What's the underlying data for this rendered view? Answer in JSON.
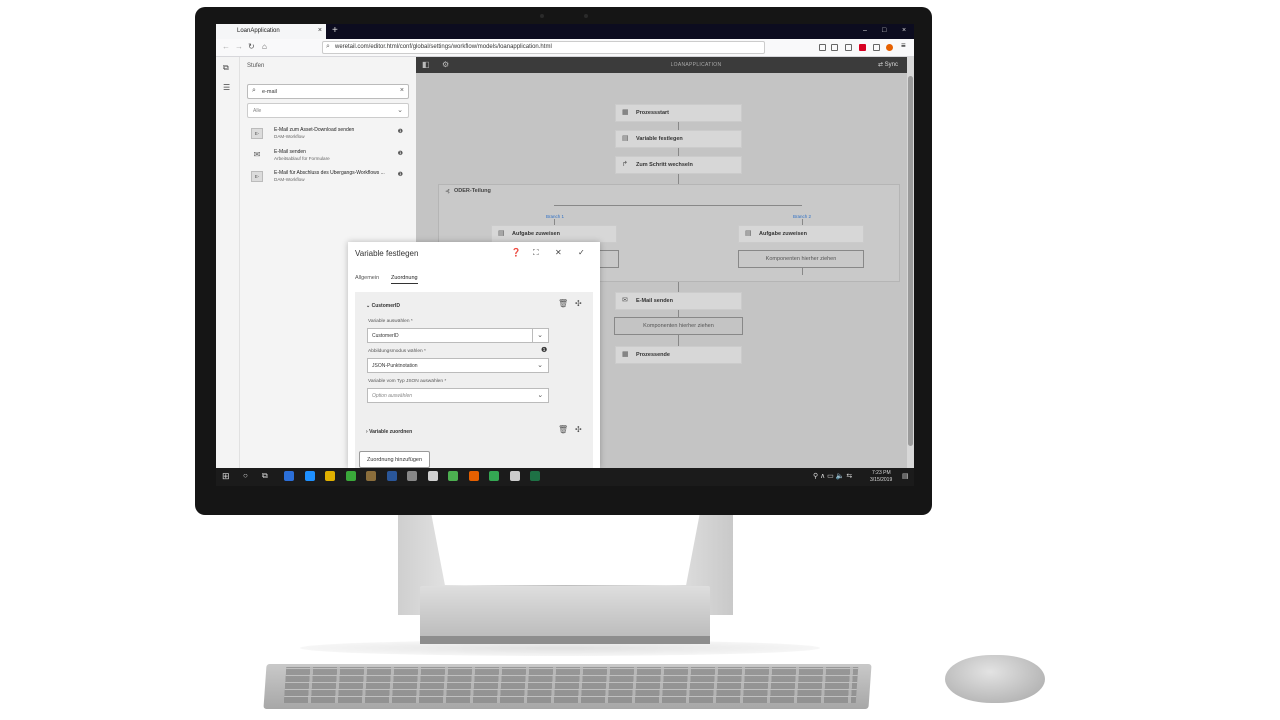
{
  "browser": {
    "tab_title": "LoanApplication",
    "tab_close": "×",
    "new_tab": "+",
    "window_controls": [
      "–",
      "□",
      "×"
    ],
    "url": "weretail.com/editor.html/conf/global/settings/workflow/models/loanapplication.html",
    "nav_icons": [
      "back-icon",
      "forward-icon",
      "reload-icon",
      "home-icon"
    ]
  },
  "rail": {
    "icons": [
      "copy-icon",
      "list-icon"
    ]
  },
  "sidebar": {
    "title": "Stufen",
    "search_value": "e-mail",
    "filter_value": "Alle",
    "steps": [
      {
        "icon_text": "E-",
        "name": "E-Mail zum Asset-Download senden",
        "sub": "DAM-Workflow"
      },
      {
        "icon_text": "✉",
        "name": "E-Mail senden",
        "sub": "Arbeitsablauf für Formulare"
      },
      {
        "icon_text": "E-",
        "name": "E-Mail für Abschluss des Übergangs-Workflows ...",
        "sub": "DAM-Workflow"
      }
    ]
  },
  "canvas": {
    "title": "LOANAPPLICATION",
    "sync_label": "Sync",
    "nodes": {
      "start": "Prozessstart",
      "set_variable": "Variable festlegen",
      "goto_step": "Zum Schritt wechseln",
      "or_split": "ODER-Teilung",
      "branch1": "Branch 1",
      "branch2": "Branch 2",
      "assign_task_1": "Aufgabe zuweisen",
      "assign_task_2": "Aufgabe zuweisen",
      "drag_here_1": "Komponenten hierher ziehen",
      "send_email": "E-Mail senden",
      "drag_here_2": "Komponenten hierher ziehen",
      "end": "Prozessende"
    }
  },
  "dialog": {
    "title": "Variable festlegen",
    "tabs": [
      "Allgemein",
      "Zuordnung"
    ],
    "active_tab": "Zuordnung",
    "section1_title": "CustomerID",
    "label_variable": "Variable auswählen *",
    "value_variable": "CustomerID",
    "label_mode": "Abbildungsmodus wählen *",
    "value_mode": "JSON-Punktnotation",
    "label_json": "Variable vom Typ JSON auswählen *",
    "placeholder_json": "Option auswählen",
    "section2_title": "Variable zuordnen",
    "add_button": "Zuordnung hinzufügen"
  },
  "taskbar": {
    "time": "7:23 PM",
    "date": "3/15/2019",
    "app_colors": [
      "#2b6fd8",
      "#1e90ff",
      "#e0b000",
      "#3aa83a",
      "#8a6d3b",
      "#2a5699",
      "#888888",
      "#d0d0d0",
      "#4caf50",
      "#e66000",
      "#34a853",
      "#cccccc",
      "#1e7145"
    ]
  }
}
